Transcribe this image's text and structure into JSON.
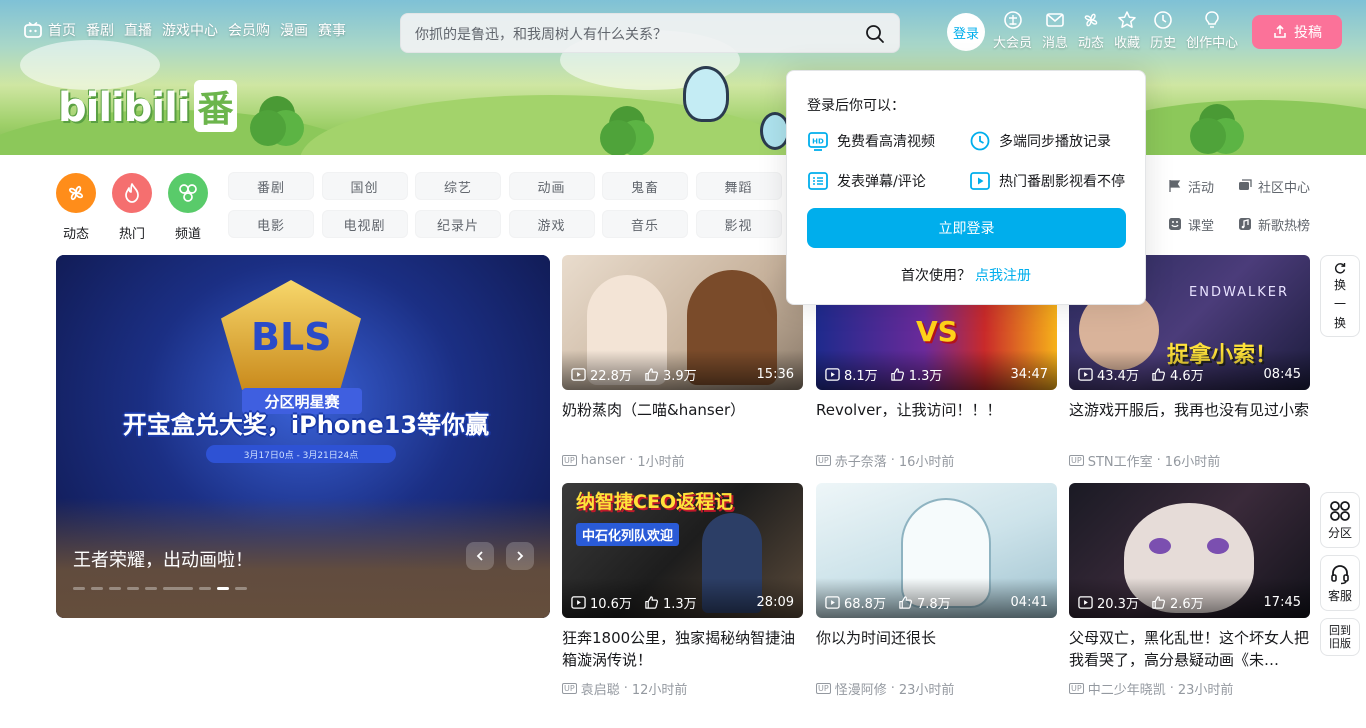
{
  "topnav": {
    "items": [
      "首页",
      "番剧",
      "直播",
      "游戏中心",
      "会员购",
      "漫画",
      "赛事"
    ]
  },
  "search": {
    "placeholder": "你抓的是鲁迅，和我周树人有什么关系？"
  },
  "header_right": {
    "login_label": "登录",
    "items": [
      "大会员",
      "消息",
      "动态",
      "收藏",
      "历史",
      "创作中心"
    ],
    "upload_label": "投稿"
  },
  "logo": {
    "text": "bilibili",
    "fan": "番"
  },
  "channels": {
    "big": [
      {
        "label": "动态",
        "color": "#ff8d1a"
      },
      {
        "label": "热门",
        "color": "#f56f6f"
      },
      {
        "label": "频道",
        "color": "#59cb6a"
      }
    ],
    "tags": [
      "番剧",
      "国创",
      "综艺",
      "动画",
      "鬼畜",
      "舞蹈",
      "电影",
      "电视剧",
      "纪录片",
      "游戏",
      "音乐",
      "影视"
    ],
    "right": [
      "活动",
      "社区中心",
      "课堂",
      "新歌热榜"
    ]
  },
  "carousel": {
    "caption": "王者荣耀，出动画啦！",
    "emblem": "BLS",
    "ribbon": "分区明星赛",
    "headline": "开宝盒兑大奖，iPhone13等你赢",
    "dates": "3月17日0点 - 3月21日24点"
  },
  "videos": [
    {
      "plays": "22.8万",
      "likes": "3.9万",
      "duration": "15:36",
      "title": "奶粉蒸肉（二喵&hanser）",
      "author": "hanser",
      "time": "1小时前"
    },
    {
      "plays": "8.1万",
      "likes": "1.3万",
      "duration": "34:47",
      "title": "Revolver，让我访问！！！",
      "author": "赤子奈落",
      "time": "16小时前"
    },
    {
      "plays": "43.4万",
      "likes": "4.6万",
      "duration": "08:45",
      "title": "这游戏开服后，我再也没有见过小索",
      "author": "STN工作室",
      "time": "16小时前"
    },
    {
      "plays": "10.6万",
      "likes": "1.3万",
      "duration": "28:09",
      "title": "狂奔1800公里，独家揭秘纳智捷油箱漩涡传说！",
      "author": "袁启聪",
      "time": "12小时前"
    },
    {
      "plays": "68.8万",
      "likes": "7.8万",
      "duration": "04:41",
      "title": "你以为时间还很长",
      "author": "怪漫阿修",
      "time": "23小时前"
    },
    {
      "plays": "20.3万",
      "likes": "2.6万",
      "duration": "17:45",
      "title": "父母双亡，黑化乱世！这个坏女人把我看哭了，高分悬疑动画《未…",
      "author": "中二少年晓凯",
      "time": "23小时前"
    }
  ],
  "thumb_text": {
    "v2": "VS",
    "v3": "捉拿小索！",
    "v3b": "ENDWALKER",
    "v4": "纳智捷CEO返程记",
    "v4b": "中石化列队欢迎"
  },
  "popover": {
    "title": "登录后你可以：",
    "features": [
      "免费看高清视频",
      "多端同步播放记录",
      "发表弹幕/评论",
      "热门番剧影视看不停"
    ],
    "login_button": "立即登录",
    "first_use": "首次使用？",
    "register_link": "点我注册"
  },
  "float": {
    "refresh": [
      "换",
      "一",
      "换"
    ],
    "zone": "分区",
    "service": "客服",
    "old": [
      "回到",
      "旧版"
    ]
  },
  "colors": {
    "accent": "#00aeec",
    "pink": "#fb7299"
  }
}
